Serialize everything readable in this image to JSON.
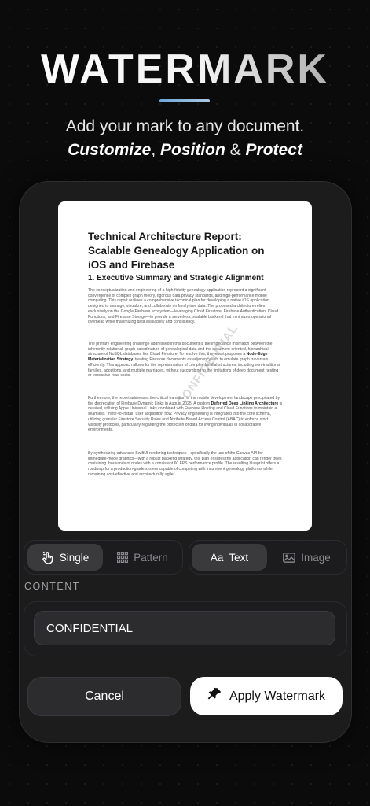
{
  "hero": {
    "title": "WATERMARK",
    "subtitle": "Add your mark to any document.",
    "tagline": {
      "word1": "Customize",
      "sep1": ", ",
      "word2": "Position",
      "sep2": " & ",
      "word3": "Protect"
    },
    "accent_color": "#8fb8e0"
  },
  "document": {
    "title": "Technical Architecture Report: Scalable Genealogy Application on iOS and Firebase",
    "heading": "1. Executive Summary and Strategic Alignment",
    "para1": "The conceptualization and engineering of a high-fidelity genealogy application represent a significant convergence of complex graph theory, rigorous data privacy standards, and high-performance mobile computing. This report outlines a comprehensive technical plan for developing a native iOS application designed to manage, visualize, and collaborate on family tree data. The proposed architecture relies exclusively on the Google Firebase ecosystem—leveraging Cloud Firestore, Firebase Authentication, Cloud Functions, and Firebase Storage—to provide a serverless, scalable backend that minimizes operational overhead while maximizing data availability and consistency.",
    "para2_a": "The primary engineering challenge addressed in this document is the impedance mismatch between the inherently relational, graph-based nature of genealogical data and the document-oriented, hierarchical structure of NoSQL databases like Cloud Firestore. To resolve this, the report proposes a ",
    "para2_bold": "Node-Edge Materialization Strategy",
    "para2_b": ", treating Firestore documents as adjacency lists to emulate graph traversals efficiently. This approach allows for the representation of complex familial structures, including non-traditional families, adoptions, and multiple marriages, without succumbing to the limitations of deep document nesting or excessive read costs.",
    "para3_a": "Furthermore, the report addresses the critical transition in the mobile development landscape precipitated by the deprecation of Firebase Dynamic Links in August 2025. A custom ",
    "para3_bold": "Deferred Deep Linking Architecture",
    "para3_b": " is detailed, utilizing Apple Universal Links combined with Firebase Hosting and Cloud Functions to maintain a seamless \"invite-to-install\" user acquisition flow. Privacy engineering is integrated into the core schema, utilizing granular Firestore Security Rules and Attribute-Based Access Control (ABAC) to enforce strict visibility protocols, particularly regarding the protection of data for living individuals in collaborative environments.",
    "para4": "By synthesizing advanced SwiftUI rendering techniques—specifically the use of the Canvas API for immediate-mode graphics—with a robust backend strategy, this plan ensures the application can render trees containing thousands of nodes with a consistent 60 FPS performance profile. The resulting blueprint offers a roadmap for a production-grade system capable of competing with incumbent genealogy platforms while remaining cost-effective and architecturally agile.",
    "watermark": "CONFIDENTIAL"
  },
  "controls": {
    "mode": {
      "single": "Single",
      "pattern": "Pattern",
      "selected": "Single"
    },
    "type": {
      "text_prefix": "Aa",
      "text": "Text",
      "image": "Image",
      "selected": "Text"
    }
  },
  "content": {
    "label": "CONTENT",
    "value": "CONFIDENTIAL"
  },
  "actions": {
    "cancel": "Cancel",
    "apply": "Apply Watermark"
  }
}
